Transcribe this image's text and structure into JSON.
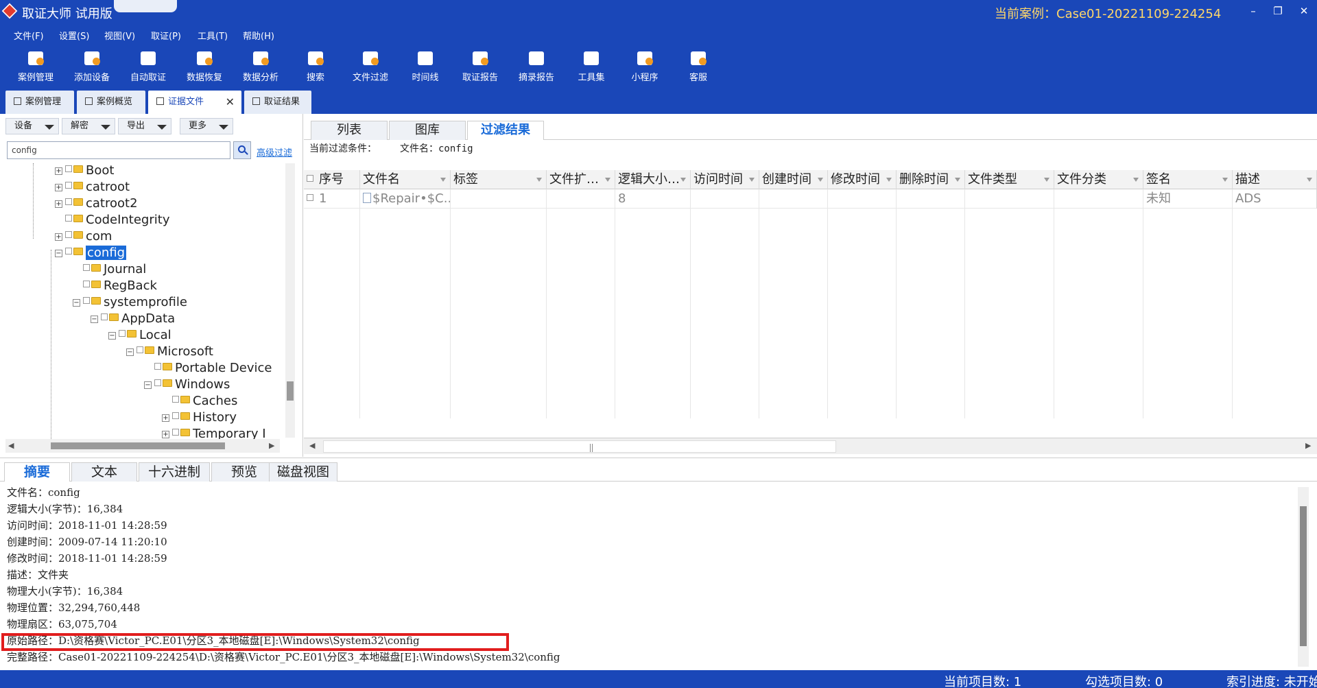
{
  "window": {
    "title": "取证大师 试用版",
    "current_case": "当前案例：Case01-20221109-224254",
    "minimize": "–",
    "restore": "❐",
    "close": "✕"
  },
  "menu": [
    "文件(F)",
    "设置(S)",
    "视图(V)",
    "取证(P)",
    "工具(T)",
    "帮助(H)"
  ],
  "toolbar": [
    {
      "label": "案例管理",
      "icon": "case-manage-icon"
    },
    {
      "label": "添加设备",
      "icon": "add-device-icon"
    },
    {
      "label": "自动取证",
      "icon": "auto-forensics-icon"
    },
    {
      "label": "数据恢复",
      "icon": "data-recovery-icon"
    },
    {
      "label": "数据分析",
      "icon": "data-analysis-icon"
    },
    {
      "label": "搜索",
      "icon": "search-icon"
    },
    {
      "label": "文件过滤",
      "icon": "file-filter-icon"
    },
    {
      "label": "时间线",
      "icon": "timeline-icon"
    },
    {
      "label": "取证报告",
      "icon": "report-icon"
    },
    {
      "label": "摘录报告",
      "icon": "excerpt-report-icon"
    },
    {
      "label": "工具集",
      "icon": "toolset-icon"
    },
    {
      "label": "小程序",
      "icon": "miniprogram-icon"
    },
    {
      "label": "客服",
      "icon": "customer-service-icon"
    }
  ],
  "doc_tabs": [
    {
      "label": "案例管理"
    },
    {
      "label": "案例概览"
    },
    {
      "label": "证据文件"
    },
    {
      "label": "取证结果"
    }
  ],
  "left": {
    "dropdowns": [
      "设备",
      "解密",
      "导出",
      "更多"
    ],
    "search_value": "config",
    "advanced_filter": "高级过滤"
  },
  "tree": [
    {
      "label": "Boot",
      "expander": "+",
      "selected": false
    },
    {
      "label": "catroot",
      "expander": "+",
      "selected": false
    },
    {
      "label": "catroot2",
      "expander": "+",
      "selected": false
    },
    {
      "label": "CodeIntegrity",
      "expander": "",
      "selected": false
    },
    {
      "label": "com",
      "expander": "+",
      "selected": false
    },
    {
      "label": "config",
      "expander": "−",
      "selected": true
    },
    {
      "label": "Journal",
      "expander": "",
      "selected": false
    },
    {
      "label": "RegBack",
      "expander": "",
      "selected": false
    },
    {
      "label": "systemprofile",
      "expander": "−",
      "selected": false
    },
    {
      "label": "AppData",
      "expander": "−",
      "selected": false
    },
    {
      "label": "Local",
      "expander": "−",
      "selected": false
    },
    {
      "label": "Microsoft",
      "expander": "−",
      "selected": false
    },
    {
      "label": "Portable Device",
      "expander": "",
      "selected": false
    },
    {
      "label": "Windows",
      "expander": "−",
      "selected": false
    },
    {
      "label": "Caches",
      "expander": "",
      "selected": false
    },
    {
      "label": "History",
      "expander": "+",
      "selected": false
    },
    {
      "label": "Temporary I",
      "expander": "+",
      "selected": false
    }
  ],
  "view_tabs": [
    "列表",
    "图库",
    "过滤结果"
  ],
  "filter": {
    "label": "当前过滤条件：",
    "value": "文件名：config"
  },
  "grid": {
    "columns": [
      "序号",
      "文件名",
      "标签",
      "文件扩…",
      "逻辑大小…",
      "访问时间",
      "创建时间",
      "修改时间",
      "删除时间",
      "文件类型",
      "文件分类",
      "签名",
      "描述"
    ],
    "rows": [
      [
        "1",
        "$Repair•$C...",
        "",
        "",
        "8",
        "",
        "",
        "",
        "",
        "",
        "",
        "未知",
        "ADS"
      ]
    ]
  },
  "bottom_tabs": [
    "摘要",
    "文本",
    "十六进制",
    "预览",
    "磁盘视图"
  ],
  "summary": [
    "文件名：config",
    "逻辑大小(字节)：16,384",
    "访问时间：2018-11-01 14:28:59",
    "创建时间：2009-07-14 11:20:10",
    "修改时间：2018-11-01 14:28:59",
    "描述：文件夹",
    "物理大小(字节)：16,384",
    "物理位置：32,294,760,448",
    "物理扇区：63,075,704",
    "原始路径：D:\\资格赛\\Victor_PC.E01\\分区3_本地磁盘[E]:\\Windows\\System32\\config",
    "完整路径：Case01-20221109-224254\\D:\\资格赛\\Victor_PC.E01\\分区3_本地磁盘[E]:\\Windows\\System32\\config"
  ],
  "status": {
    "current_items": "当前项目数: 1",
    "checked_items": "勾选项目数: 0",
    "index_progress": "索引进度: 未开始"
  },
  "colors": {
    "brand": "#1a47b8",
    "highlight_box": "#e11d1d",
    "active_tab_text": "#1a6bd8"
  }
}
